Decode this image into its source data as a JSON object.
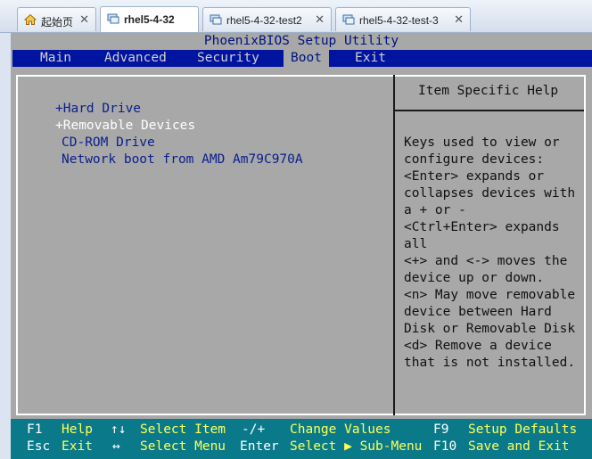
{
  "tabs": [
    {
      "label": "起始页",
      "icon": "home-icon",
      "active": false
    },
    {
      "label": "rhel5-4-32",
      "icon": "vm-icon",
      "active": true
    },
    {
      "label": "rhel5-4-32-test2",
      "icon": "vm-icon",
      "active": false
    },
    {
      "label": "rhel5-4-32-test-3",
      "icon": "vm-icon",
      "active": false
    }
  ],
  "tab_close_glyph": "✕",
  "bios": {
    "title": "PhoenixBIOS Setup Utility",
    "menu": [
      {
        "label": "Main"
      },
      {
        "label": "Advanced"
      },
      {
        "label": "Security"
      },
      {
        "label": "Boot",
        "selected": true
      },
      {
        "label": "Exit"
      }
    ],
    "boot_items": [
      {
        "label": "+Hard Drive",
        "highlighted": false
      },
      {
        "label": "+Removable Devices",
        "highlighted": true
      },
      {
        "label": "CD-ROM Drive",
        "highlighted": false
      },
      {
        "label": "Network boot from AMD Am79C970A",
        "highlighted": false
      }
    ],
    "help_title": "Item Specific Help",
    "help_lines": [
      "Keys used to view or",
      "configure devices:",
      "<Enter> expands or",
      "collapses devices with",
      "a + or -",
      "<Ctrl+Enter> expands",
      "all",
      "<+> and <-> moves the",
      "device up or down.",
      "<n> May move removable",
      "device between Hard",
      "Disk or Removable Disk",
      "<d> Remove a device",
      "that is not installed."
    ],
    "footer": {
      "row1": [
        {
          "key": "F1",
          "action": "Help"
        },
        {
          "key": "↑↓",
          "action": "Select Item"
        },
        {
          "key": "-/+",
          "action": "Change Values"
        },
        {
          "key": "F9",
          "action": "Setup Defaults"
        }
      ],
      "row2": [
        {
          "key": "Esc",
          "action": "Exit"
        },
        {
          "key": "↔",
          "action": "Select Menu"
        },
        {
          "key": "Enter",
          "action": "Select ▶ Sub-Menu"
        },
        {
          "key": "F10",
          "action": "Save and Exit"
        }
      ]
    }
  },
  "colors": {
    "bios_bg": "#a8a8a8",
    "menubar": "#0014a0",
    "footer": "#0a7a8a",
    "item_text": "#0a1e8c"
  }
}
